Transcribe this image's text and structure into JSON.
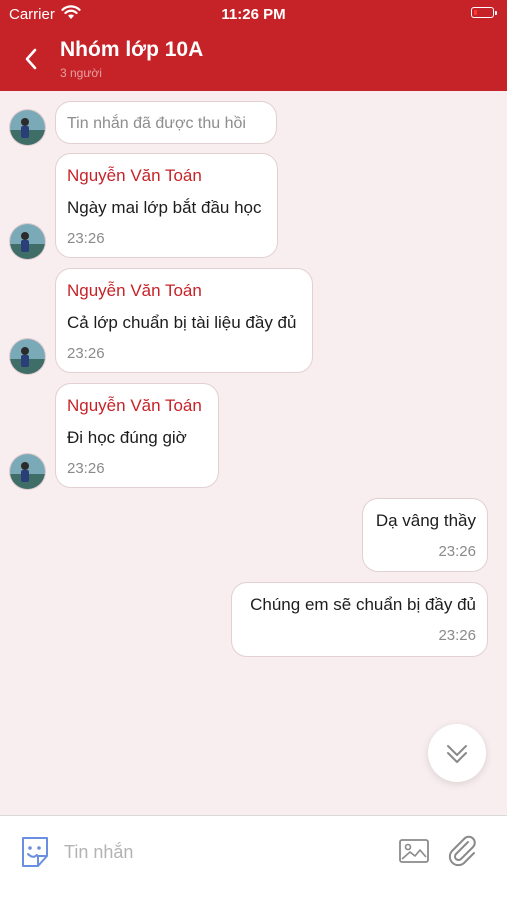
{
  "status_bar": {
    "carrier": "Carrier",
    "time": "11:26 PM"
  },
  "header": {
    "title": "Nhóm lớp 10A",
    "subtitle": "3 người"
  },
  "messages": [
    {
      "type": "recalled",
      "text": "Tin nhắn đã được thu hồi"
    },
    {
      "type": "incoming",
      "sender": "Nguyễn Văn Toán",
      "text": "Ngày mai lớp bắt đầu học",
      "time": "23:26"
    },
    {
      "type": "incoming",
      "sender": "Nguyễn Văn Toán",
      "text": "Cả lớp chuẩn bị tài liệu đầy đủ",
      "time": "23:26"
    },
    {
      "type": "incoming",
      "sender": "Nguyễn Văn Toán",
      "text": "Đi học đúng giờ",
      "time": "23:26"
    },
    {
      "type": "outgoing",
      "text": "Dạ vâng thầy",
      "time": "23:26"
    },
    {
      "type": "outgoing",
      "text": "Chúng em sẽ chuẩn bị đầy đủ",
      "time": "23:26"
    }
  ],
  "input": {
    "placeholder": "Tin nhắn",
    "value": ""
  },
  "icons": {
    "back": "chevron-left-icon",
    "wifi": "wifi-icon",
    "battery": "battery-icon",
    "sticker": "sticker-icon",
    "image": "image-icon",
    "attach": "paperclip-icon",
    "scroll": "double-chevron-down-icon"
  },
  "colors": {
    "brand": "#c62329",
    "background": "#f8eeef",
    "bubble": "#ffffff",
    "sticker": "#6b8fe0"
  }
}
